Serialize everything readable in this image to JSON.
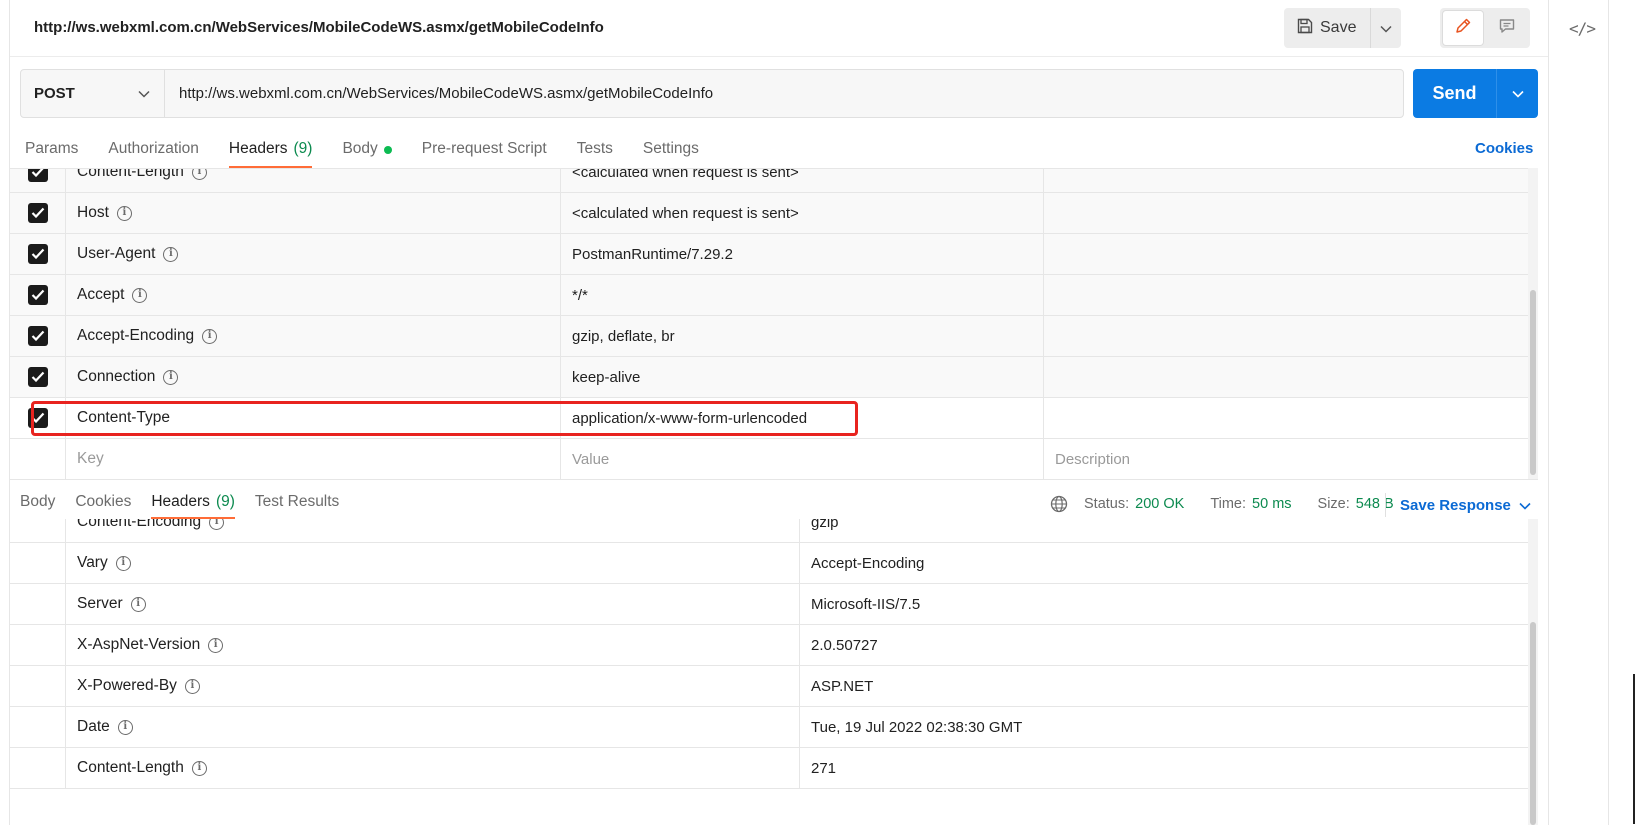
{
  "header": {
    "title": "http://ws.webxml.com.cn/WebServices/MobileCodeWS.asmx/getMobileCodeInfo",
    "save_label": "Save"
  },
  "rail": {
    "code_icon": "</>"
  },
  "request": {
    "method": "POST",
    "url": "http://ws.webxml.com.cn/WebServices/MobileCodeWS.asmx/getMobileCodeInfo",
    "send_label": "Send"
  },
  "request_tabs": {
    "params": "Params",
    "authorization": "Authorization",
    "headers": "Headers",
    "headers_count": "(9)",
    "body": "Body",
    "pre_request": "Pre-request Script",
    "tests": "Tests",
    "settings": "Settings",
    "cookies": "Cookies"
  },
  "request_headers": {
    "rows": [
      {
        "key": "Content-Length",
        "value": "<calculated when request is sent>"
      },
      {
        "key": "Host",
        "value": "<calculated when request is sent>"
      },
      {
        "key": "User-Agent",
        "value": "PostmanRuntime/7.29.2"
      },
      {
        "key": "Accept",
        "value": "*/*"
      },
      {
        "key": "Accept-Encoding",
        "value": "gzip, deflate, br"
      },
      {
        "key": "Connection",
        "value": "keep-alive"
      },
      {
        "key": "Content-Type",
        "value": "application/x-www-form-urlencoded"
      }
    ],
    "placeholder": {
      "key": "Key",
      "value": "Value",
      "description": "Description"
    }
  },
  "response_tabs": {
    "body": "Body",
    "cookies": "Cookies",
    "headers": "Headers",
    "headers_count": "(9)",
    "test_results": "Test Results"
  },
  "response_meta": {
    "status_label": "Status:",
    "status_value": "200 OK",
    "time_label": "Time:",
    "time_value": "50 ms",
    "size_label": "Size:",
    "size_value": "548 B",
    "save_response": "Save Response"
  },
  "response_headers": {
    "rows": [
      {
        "key": "Content-Encoding",
        "value": "gzip"
      },
      {
        "key": "Vary",
        "value": "Accept-Encoding"
      },
      {
        "key": "Server",
        "value": "Microsoft-IIS/7.5"
      },
      {
        "key": "X-AspNet-Version",
        "value": "2.0.50727"
      },
      {
        "key": "X-Powered-By",
        "value": "ASP.NET"
      },
      {
        "key": "Date",
        "value": "Tue, 19 Jul 2022 02:38:30 GMT"
      },
      {
        "key": "Content-Length",
        "value": "271"
      }
    ]
  },
  "colors": {
    "accent_orange": "#ff6c37",
    "send_blue": "#0b7be3",
    "link_blue": "#0b6ad4",
    "status_green": "#0c8a4f",
    "highlight_red": "#e8231f"
  }
}
